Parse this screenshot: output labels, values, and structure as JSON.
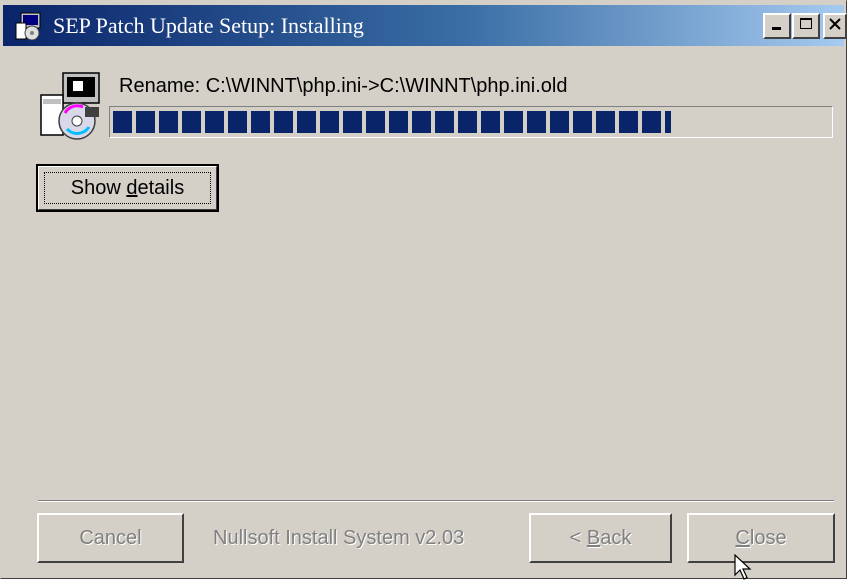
{
  "window": {
    "title": "SEP Patch Update Setup: Installing",
    "title_icon": "installer-app-icon",
    "controls": {
      "minimize_icon": "minimize-icon",
      "maximize_icon": "maximize-icon",
      "close_icon": "close-icon"
    }
  },
  "status": {
    "icon": "installer-disc-icon",
    "text": "Rename: C:\\WINNT\\php.ini->C:\\WINNT\\php.ini.old",
    "progress": 0.78
  },
  "buttons": {
    "show_details": {
      "prefix": "Show ",
      "mnemonic": "d",
      "suffix": "etails"
    },
    "cancel": {
      "label": "Cancel",
      "enabled": false
    },
    "back": {
      "prefix": "< ",
      "mnemonic": "B",
      "suffix": "ack",
      "enabled": false
    },
    "close": {
      "prefix": "",
      "mnemonic": "C",
      "suffix": "lose",
      "enabled": false
    }
  },
  "branding": "Nullsoft Install System v2.03",
  "colors": {
    "title_gradient_start": "#0a246a",
    "title_gradient_end": "#a6caf0",
    "progress_fill": "#0a246a",
    "face": "#d4d0c8"
  }
}
